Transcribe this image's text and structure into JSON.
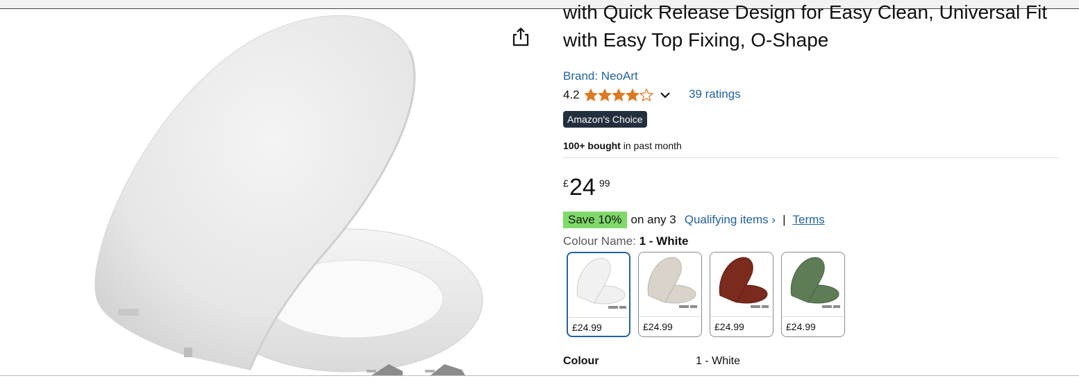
{
  "product": {
    "title": "with Quick Release Design for Easy Clean, Universal Fit with Easy Top Fixing, O-Shape",
    "brand": "Brand: NeoArt",
    "rating": "4.2",
    "rating_value": 4.2,
    "ratings_count": "39 ratings",
    "badge": "Amazon's Choice",
    "bought_bold": "100+ bought",
    "bought_rest": " in past month",
    "price": {
      "symbol": "£",
      "whole": "24",
      "fraction": "99"
    },
    "promo": {
      "badge": "Save 10%",
      "text": "on any 3",
      "link": "Qualifying items ›",
      "separator": "|",
      "terms": "Terms"
    },
    "colour_label": "Colour Name:",
    "colour_value": "1 - White",
    "swatches": [
      {
        "price": "£24.99",
        "color": "#f1f1f1"
      },
      {
        "price": "£24.99",
        "color": "#d9d3ca"
      },
      {
        "price": "£24.99",
        "color": "#7b2a1e"
      },
      {
        "price": "£24.99",
        "color": "#5e7d56"
      }
    ],
    "specs": [
      {
        "key": "Colour",
        "value": "1 - White"
      }
    ]
  },
  "icons": {
    "share": "share-icon",
    "star": "star-icon",
    "chevron": "chevron-down-icon"
  },
  "colors": {
    "link": "#2162a1",
    "star": "#ffa41c",
    "save_badge": "#7fda69",
    "choice_badge": "#232f3e"
  }
}
